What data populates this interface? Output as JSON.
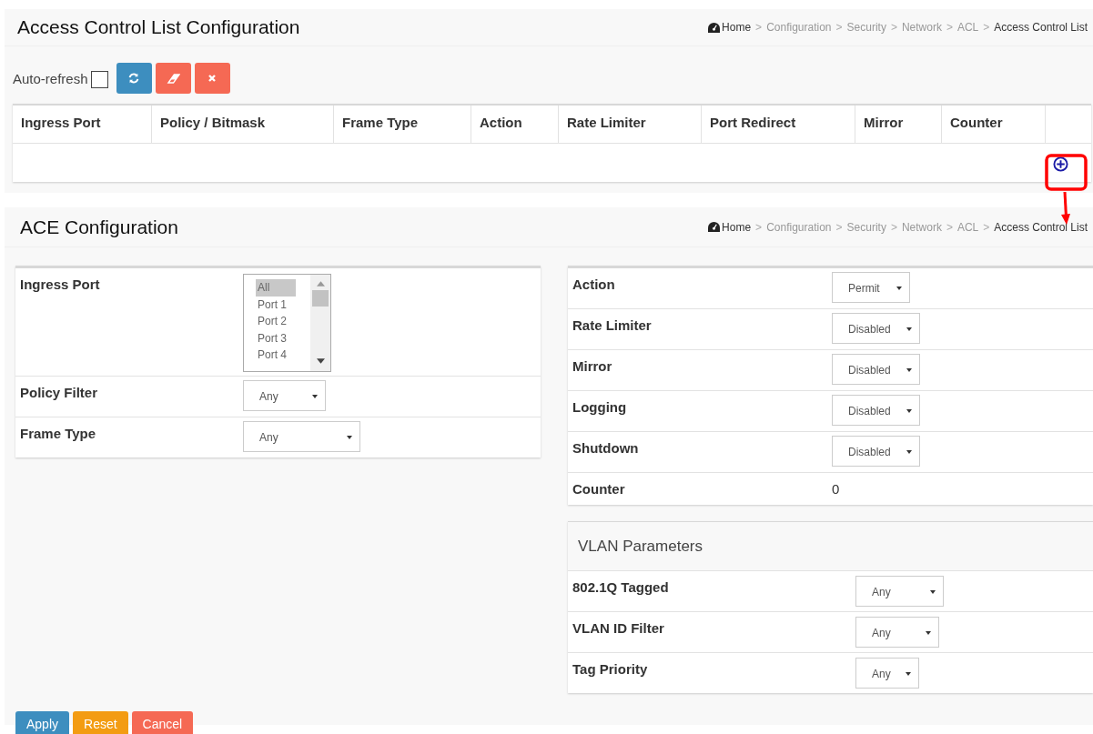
{
  "acl_panel": {
    "title": "Access Control List Configuration",
    "breadcrumb": [
      {
        "label": "Home",
        "kind": "home"
      },
      {
        "separator": ">",
        "label": "Configuration",
        "kind": "link"
      },
      {
        "separator": ">",
        "label": "Security",
        "kind": "link"
      },
      {
        "separator": ">",
        "label": "Network",
        "kind": "link"
      },
      {
        "separator": ">",
        "label": "ACL",
        "kind": "link"
      },
      {
        "separator": ">",
        "label": "Access Control List",
        "kind": "current"
      }
    ],
    "auto_refresh": {
      "label": "Auto-refresh",
      "checked": false
    },
    "toolbar_buttons": [
      {
        "kind": "refresh"
      },
      {
        "kind": "clear"
      },
      {
        "kind": "delete"
      }
    ],
    "table": {
      "columns": [
        "Ingress Port",
        "Policy / Bitmask",
        "Frame Type",
        "Action",
        "Rate Limiter",
        "Port Redirect",
        "Mirror",
        "Counter"
      ]
    }
  },
  "ace_panel": {
    "title": "ACE Configuration",
    "breadcrumb": [
      {
        "label": "Home",
        "kind": "home"
      },
      {
        "separator": ">",
        "label": "Configuration",
        "kind": "link"
      },
      {
        "separator": ">",
        "label": "Security",
        "kind": "link"
      },
      {
        "separator": ">",
        "label": "Network",
        "kind": "link"
      },
      {
        "separator": ">",
        "label": "ACL",
        "kind": "link"
      },
      {
        "separator": ">",
        "label": "Access Control List",
        "kind": "current"
      }
    ],
    "left_rows": [
      {
        "label": "Ingress Port",
        "kind": "listbox",
        "options": [
          {
            "label": "All",
            "selected": true
          },
          {
            "label": "Port 1",
            "selected": false
          },
          {
            "label": "Port 2",
            "selected": false
          },
          {
            "label": "Port 3",
            "selected": false
          },
          {
            "label": "Port 4",
            "selected": false
          }
        ]
      },
      {
        "label": "Policy Filter",
        "kind": "select",
        "value": "Any"
      },
      {
        "label": "Frame Type",
        "kind": "select",
        "value": "Any"
      }
    ],
    "right_rows": [
      {
        "label": "Action",
        "kind": "select",
        "value": "Permit"
      },
      {
        "label": "Rate Limiter",
        "kind": "select",
        "value": "Disabled"
      },
      {
        "label": "Mirror",
        "kind": "select",
        "value": "Disabled"
      },
      {
        "label": "Logging",
        "kind": "select",
        "value": "Disabled"
      },
      {
        "label": "Shutdown",
        "kind": "select",
        "value": "Disabled"
      },
      {
        "label": "Counter",
        "kind": "text",
        "value": "0"
      }
    ],
    "vlan": {
      "title": "VLAN Parameters",
      "rows": [
        {
          "label": "802.1Q Tagged",
          "kind": "select",
          "value": "Any"
        },
        {
          "label": "VLAN ID Filter",
          "kind": "select",
          "value": "Any"
        },
        {
          "label": "Tag Priority",
          "kind": "select",
          "value": "Any"
        }
      ]
    }
  },
  "buttons": [
    {
      "label": "Apply",
      "kind": "primary"
    },
    {
      "label": "Reset",
      "kind": "warning"
    },
    {
      "label": "Cancel",
      "kind": "danger"
    }
  ]
}
